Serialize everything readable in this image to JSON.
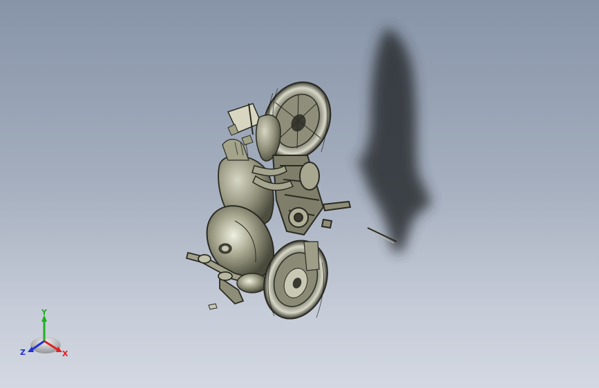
{
  "viewport": {
    "background_top": "#8794a8",
    "background_bottom": "#d3d8e2",
    "model_color": "#b4b49c",
    "shadow_color": "#2b2e33"
  },
  "triad": {
    "x_label": "X",
    "y_label": "Y",
    "z_label": "Z",
    "x_color": "#e02020",
    "y_color": "#20b020",
    "z_color": "#2030d8"
  },
  "icons": [
    "coordinate-triad-icon",
    "motorcycle-model"
  ]
}
